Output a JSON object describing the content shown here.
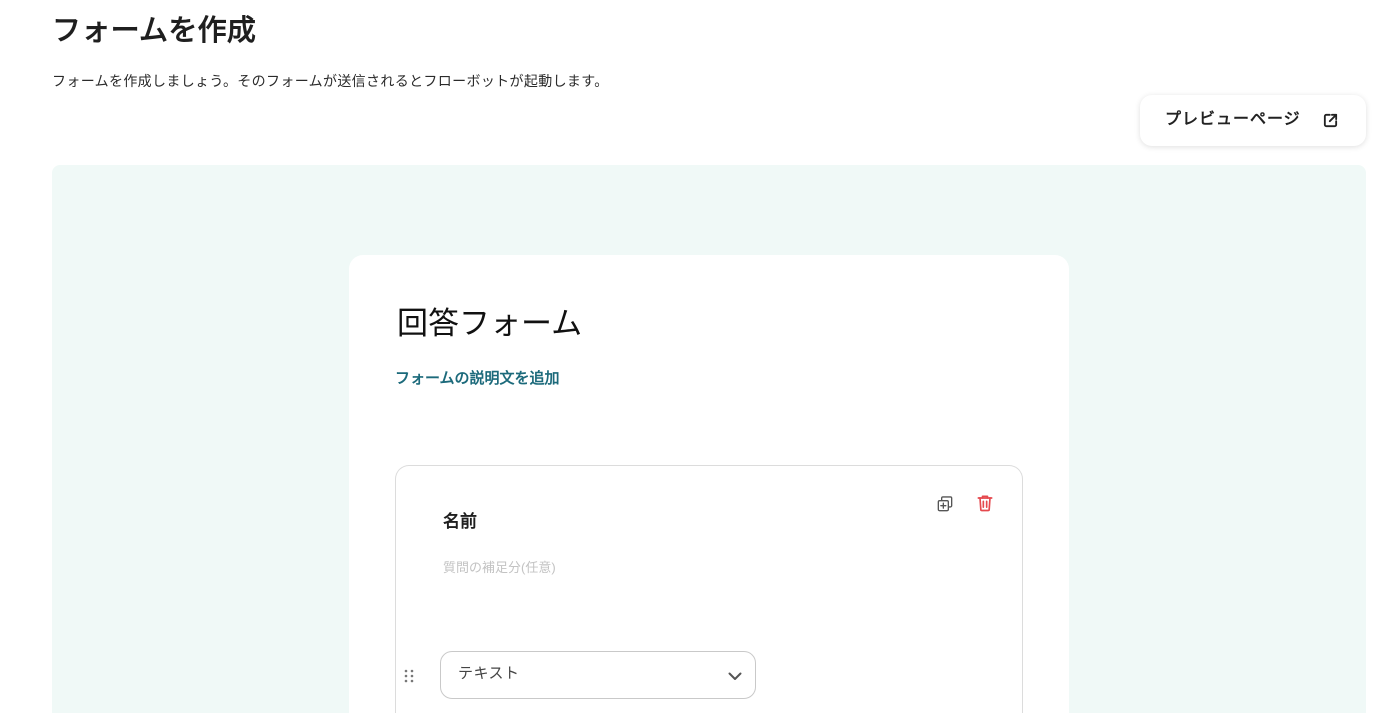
{
  "header": {
    "title": "フォームを作成",
    "description": "フォームを作成しましょう。そのフォームが送信されるとフローボットが起動します。"
  },
  "toolbar": {
    "preview_button": {
      "label": "プレビューページ",
      "icon": "external-link-icon"
    }
  },
  "form": {
    "title": "回答フォーム",
    "add_description_link": "フォームの説明文を追加",
    "questions": [
      {
        "title": "名前",
        "description_placeholder": "質問の補足分(任意)",
        "answer_type": "テキスト",
        "duplicate_icon": "copy-icon",
        "delete_icon": "trash-icon",
        "drag_icon": "drag-handle-icon",
        "select_icon": "chevron-down-icon"
      }
    ]
  },
  "colors": {
    "canvas_background": "#f0f9f7",
    "link": "#1c6a7b",
    "delete": "#e5484d",
    "text_primary": "#222222"
  }
}
